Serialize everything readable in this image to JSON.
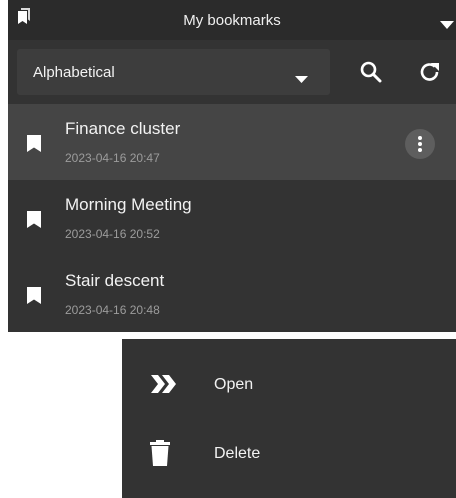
{
  "header": {
    "title": "My bookmarks",
    "book_icon": "bookmarks-icon",
    "menu_icon": "caret-down-icon"
  },
  "toolbar": {
    "sort_value": "Alphabetical",
    "search_icon": "search-icon",
    "refresh_icon": "refresh-icon"
  },
  "bookmarks": [
    {
      "name": "Finance cluster",
      "date": "2023-04-16 20:47",
      "selected": true
    },
    {
      "name": "Morning Meeting",
      "date": "2023-04-16 20:52",
      "selected": false
    },
    {
      "name": "Stair descent",
      "date": "2023-04-16 20:48",
      "selected": false
    }
  ],
  "context_menu": {
    "items": [
      {
        "label": "Open",
        "icon": "double-chevron-right-icon"
      },
      {
        "label": "Delete",
        "icon": "trash-icon"
      }
    ]
  },
  "colors": {
    "panel": "#333333",
    "header": "#2b2b2b",
    "selected_row": "#454545",
    "select_bg": "#3d3d3d",
    "text": "#f2f2f2",
    "subtext": "#9c9c9c"
  }
}
